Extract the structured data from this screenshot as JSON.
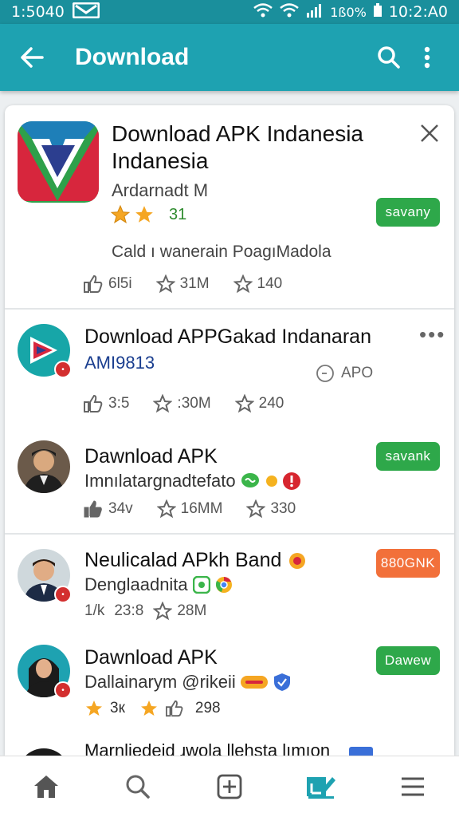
{
  "status_bar": {
    "time": "1:5040",
    "right_text": "1ß0%",
    "clock": "10:2:A0"
  },
  "app_bar": {
    "title": "Download"
  },
  "featured": {
    "title_line1": "Download APK Indanesia",
    "title_line2": "Indanesia",
    "developer": "Ardarnadt M",
    "rating_text": "31",
    "button_label": "savany",
    "description": "Cald ı wanerain PoagıMadola",
    "likes": "6l5i",
    "downloads": "31M",
    "stars": "140"
  },
  "items": [
    {
      "title": "Download APPGakad Indanaran",
      "subtitle": "AMI9813",
      "status": "APO",
      "likes": "3:5",
      "downloads": ":30M",
      "stars": "240"
    },
    {
      "title": "Dawnload APK",
      "subtitle": "Imnılatargnadtefato",
      "button_label": "savank",
      "likes": "34v",
      "downloads": "16MM",
      "stars": "330"
    },
    {
      "title": "Neulicalad APkh Band",
      "subtitle": "Denglaadnita",
      "button_label": "880GNK",
      "likes": "1/k",
      "downloads": "23:8",
      "stars": "28M"
    },
    {
      "title": "Dawnload APK",
      "subtitle": "Dallainarym @rikeii",
      "button_label": "Dawew",
      "rating": "3к",
      "stars": "298"
    },
    {
      "title": "Marnliedeid ɹwola llehsta lımıon"
    }
  ],
  "colors": {
    "teal_dark": "#1a8f9c",
    "teal": "#1ea2b1",
    "green": "#2ea84a",
    "orange": "#f2703a",
    "star": "#f5a623"
  }
}
